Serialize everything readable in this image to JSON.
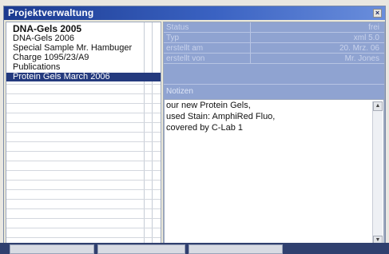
{
  "window": {
    "title": "Projektverwaltung",
    "close_glyph": "×"
  },
  "projects": [
    {
      "label": "DNA-Gels 2005",
      "bold": true
    },
    {
      "label": "DNA-Gels 2006"
    },
    {
      "label": "Special Sample Mr. Hambuger"
    },
    {
      "label": "Charge 1095/23/A9"
    },
    {
      "label": "Publications"
    },
    {
      "label": "Protein Gels March 2006",
      "selected": true
    }
  ],
  "properties": [
    {
      "label": "Status",
      "value": "frei"
    },
    {
      "label": "Typ",
      "value": "xml 5.0"
    },
    {
      "label": "erstellt am",
      "value": "20. Mrz. 06"
    },
    {
      "label": "erstellt von",
      "value": "Mr. Jones"
    }
  ],
  "notes": {
    "label": "Notizen",
    "lines": [
      "our new Protein Gels,",
      "used Stain: AmphiRed Fluo,",
      "covered by C-Lab 1"
    ]
  },
  "scroll": {
    "up_glyph": "▲",
    "down_glyph": "▼"
  },
  "colors": {
    "title_start": "#1b3a8f",
    "selected_bg": "#243a7e",
    "props_bg": "#8fa3d1"
  }
}
